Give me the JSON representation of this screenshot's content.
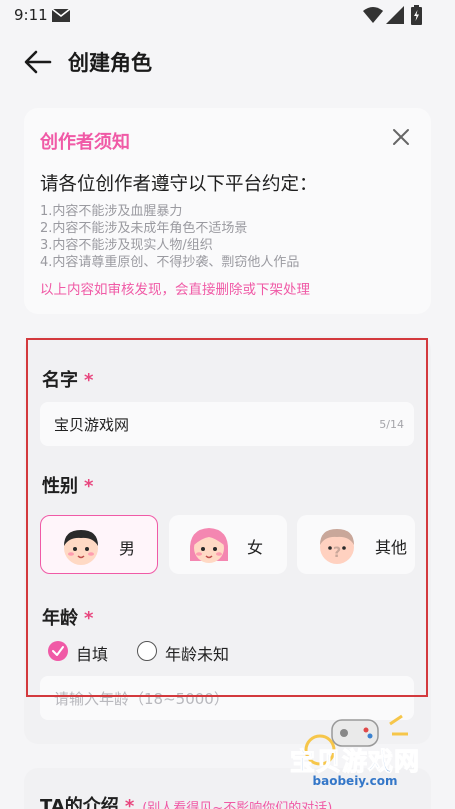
{
  "status_bar": {
    "time": "9:11",
    "icons": [
      "mail-icon",
      "wifi-icon",
      "cellular-icon",
      "battery-icon"
    ]
  },
  "header": {
    "title": "创建角色",
    "back_icon": "arrow-left-icon"
  },
  "notice": {
    "title": "创作者须知",
    "heading": "请各位创作者遵守以下平台约定：",
    "rules": [
      "1.内容不能涉及血腥暴力",
      "2.内容不能涉及未成年角色不适场景",
      "3.内容不能涉及现实人物/组织",
      "4.内容请尊重原创、不得抄袭、剽窃他人作品"
    ],
    "warning": "以上内容如审核发现，会直接删除或下架处理",
    "close_icon": "close-icon"
  },
  "form": {
    "name": {
      "label": "名字",
      "required_mark": "*",
      "value": "宝贝游戏网",
      "counter": "5/14"
    },
    "gender": {
      "label": "性别",
      "required_mark": "*",
      "options": [
        {
          "label": "男",
          "icon": "boy-avatar-icon",
          "selected": true
        },
        {
          "label": "女",
          "icon": "girl-avatar-icon",
          "selected": false
        },
        {
          "label": "其他",
          "icon": "unknown-avatar-icon",
          "selected": false
        }
      ]
    },
    "age": {
      "label": "年龄",
      "required_mark": "*",
      "options": [
        {
          "label": "自填",
          "selected": true
        },
        {
          "label": "年龄未知",
          "selected": false
        }
      ],
      "placeholder": "请输入年龄（18~5000）"
    },
    "intro": {
      "label": "TA的介绍",
      "required_mark": "*",
      "hint": "(别人看得见~不影响你们的对话)"
    }
  },
  "watermark": {
    "text": "宝贝游戏网",
    "url": "baobeiy.com"
  },
  "colors": {
    "accent": "#f05aa6",
    "highlight_border": "#d3393d",
    "background": "#f5f5f7",
    "watermark": "#3477c8"
  }
}
